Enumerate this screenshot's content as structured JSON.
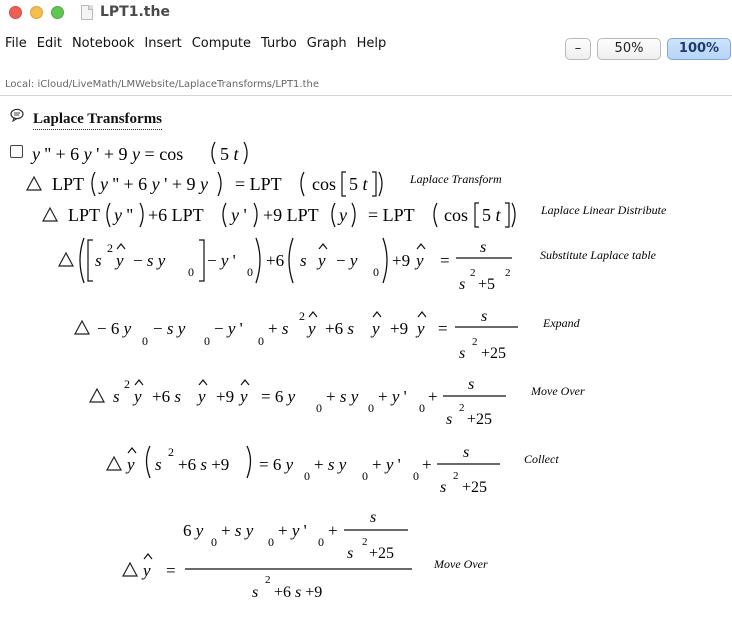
{
  "window": {
    "title": "LPT1.the",
    "colors": {
      "close": "#ec5f57",
      "minimize": "#f4be4f",
      "zoom": "#62c655"
    }
  },
  "menu": [
    "File",
    "Edit",
    "Notebook",
    "Insert",
    "Compute",
    "Turbo",
    "Graph",
    "Help"
  ],
  "zoom_controls": {
    "minus": "–",
    "half": "50%",
    "full": "100%",
    "selected": "100%"
  },
  "location": "Local:  iCloud/LiveMath/LMWebsite/LaplaceTransforms/LPT1.the",
  "notebook": {
    "section_title": "Laplace Transforms",
    "comments": [
      "Laplace Transform",
      "Laplace Linear Distribute",
      "Substitute Laplace table",
      "Expand",
      "Move Over",
      "Collect",
      "Move Over"
    ]
  }
}
